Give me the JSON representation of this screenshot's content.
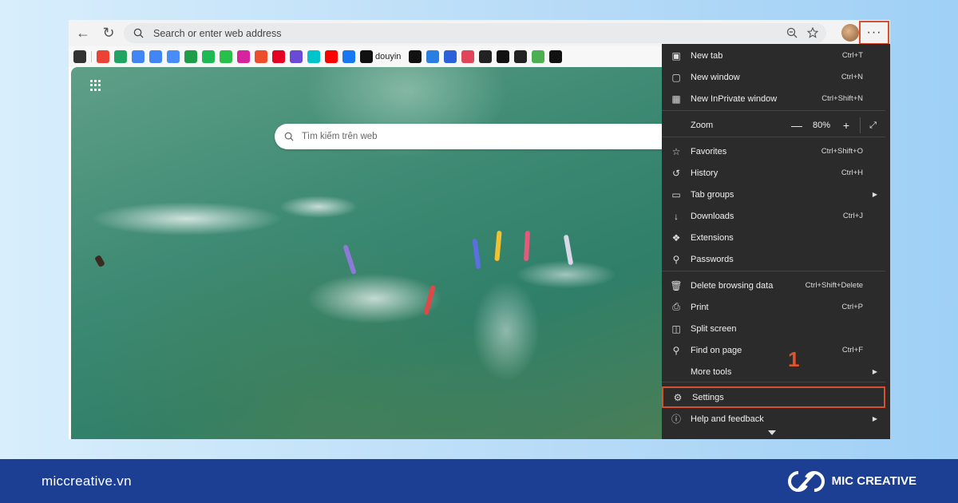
{
  "browser": {
    "address_placeholder": "Search or enter web address",
    "favorites": [
      {
        "icon": "reading-list-icon",
        "color": "#333333"
      },
      {
        "icon": "gmail-icon",
        "color": "#ea4335"
      },
      {
        "icon": "google-drive-icon",
        "color": "#1fa463"
      },
      {
        "icon": "google-ads-icon",
        "color": "#4285f4"
      },
      {
        "icon": "google-docs-icon",
        "color": "#4285f4"
      },
      {
        "icon": "gemini-icon",
        "color": "#4a8cf7"
      },
      {
        "icon": "plus-green-icon",
        "color": "#1e9e48"
      },
      {
        "icon": "spotify-icon",
        "color": "#1db954"
      },
      {
        "icon": "podcast-icon",
        "color": "#26c04a"
      },
      {
        "icon": "instagram-icon",
        "color": "#d6249f"
      },
      {
        "icon": "shopee-icon",
        "color": "#ee4d2d"
      },
      {
        "icon": "pinterest-icon",
        "color": "#e60023"
      },
      {
        "icon": "gem-icon",
        "color": "#6a4bd8"
      },
      {
        "icon": "canva-icon",
        "color": "#00c4cc"
      },
      {
        "icon": "youtube-icon",
        "color": "#ff0000"
      },
      {
        "icon": "facebook-icon",
        "color": "#1877f2"
      },
      {
        "icon": "tiktok-icon",
        "color": "#111111",
        "label": "douyin"
      },
      {
        "icon": "x-icon",
        "color": "#111111"
      },
      {
        "icon": "copilot-icon",
        "color": "#2a7de1"
      },
      {
        "icon": "forms-icon",
        "color": "#2b62d9"
      },
      {
        "icon": "red-app-icon",
        "color": "#e0455a"
      },
      {
        "icon": "w-app-icon",
        "color": "#222222"
      },
      {
        "icon": "capcut-icon",
        "color": "#111111"
      },
      {
        "icon": "w-app-2-icon",
        "color": "#222222"
      },
      {
        "icon": "battery-icon",
        "color": "#4caf50"
      },
      {
        "icon": "x-2-icon",
        "color": "#111111"
      }
    ]
  },
  "page": {
    "search_placeholder": "Tìm kiếm trên web"
  },
  "menu": {
    "items": [
      {
        "label": "New tab",
        "shortcut": "Ctrl+T",
        "icon": "new-tab-icon"
      },
      {
        "label": "New window",
        "shortcut": "Ctrl+N",
        "icon": "new-window-icon"
      },
      {
        "label": "New InPrivate window",
        "shortcut": "Ctrl+Shift+N",
        "icon": "inprivate-icon"
      },
      {
        "label": "Zoom",
        "zoom_value": "80%"
      },
      {
        "label": "Favorites",
        "shortcut": "Ctrl+Shift+O",
        "icon": "star-icon"
      },
      {
        "label": "History",
        "shortcut": "Ctrl+H",
        "icon": "history-icon"
      },
      {
        "label": "Tab groups",
        "icon": "tab-groups-icon"
      },
      {
        "label": "Downloads",
        "shortcut": "Ctrl+J",
        "icon": "download-icon"
      },
      {
        "label": "Extensions",
        "icon": "puzzle-icon"
      },
      {
        "label": "Passwords",
        "icon": "key-icon"
      },
      {
        "label": "Delete browsing data",
        "shortcut": "Ctrl+Shift+Delete",
        "icon": "trash-icon"
      },
      {
        "label": "Print",
        "shortcut": "Ctrl+P",
        "icon": "printer-icon"
      },
      {
        "label": "Split screen",
        "icon": "split-screen-icon"
      },
      {
        "label": "Find on page",
        "shortcut": "Ctrl+F",
        "icon": "find-icon"
      },
      {
        "label": "More tools",
        "icon": "more-tools-icon"
      },
      {
        "label": "Settings",
        "icon": "gear-icon"
      },
      {
        "label": "Help and feedback",
        "icon": "help-icon"
      }
    ],
    "step_number": "1"
  },
  "footer": {
    "website": "miccreative.vn",
    "brand": "MIC CREATIVE",
    "accent_color": "#1c3f94",
    "highlight_color": "#d9502e"
  }
}
